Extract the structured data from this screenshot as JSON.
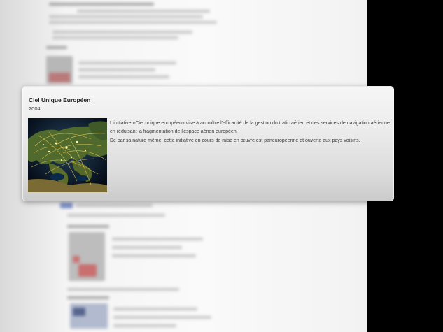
{
  "popup": {
    "title": "Ciel Unique Européen",
    "year": "2004",
    "image_icon": "europe-night-map-image",
    "paragraphs": [
      "L'initiative «Ciel unique européen» vise à accroître l'efficacité de la gestion du trafic aérien et des services de navigation aérienne en réduisant la fragmentation de l'espace aérien européen.",
      "De par sa nature même, cette initiative en cours de mise en œuvre est paneuropéenne et ouverte aux pays voisins."
    ]
  },
  "colors": {
    "background_right": "#000000",
    "page_background": "#f4f4f4",
    "card_top": "#f6f6f6",
    "card_bottom": "#cbcbcb",
    "title_text": "#1c1c1c",
    "body_text": "#3c3c3c"
  }
}
